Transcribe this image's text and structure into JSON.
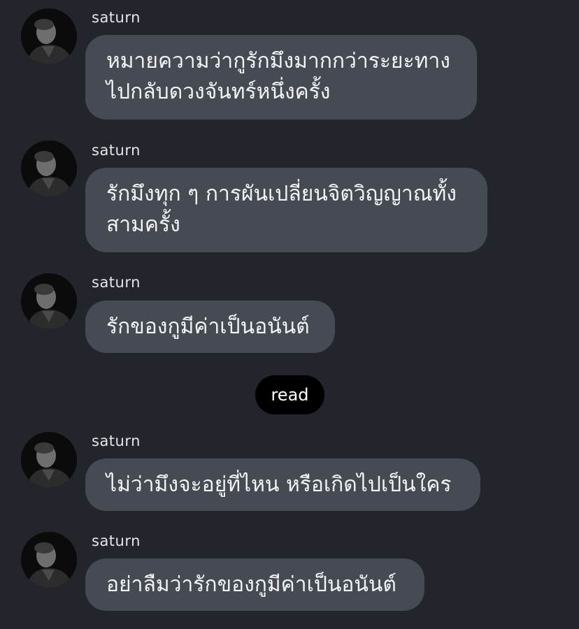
{
  "messages": [
    {
      "sender": "saturn",
      "text": "หมายความว่ากูรักมึงมากกว่าระยะทาง\nไปกลับดวงจันทร์หนึ่งครั้ง"
    },
    {
      "sender": "saturn",
      "text": "รักมึงทุก ๆ การผันเปลี่ยนจิตวิญญาณทั้ง\nสามครั้ง"
    },
    {
      "sender": "saturn",
      "text": "รักของกูมีค่าเป็นอนันต์"
    },
    {
      "sender": "saturn",
      "text": "ไม่ว่ามึงจะอยู่ที่ไหน หรือเกิดไปเป็นใคร"
    },
    {
      "sender": "saturn",
      "text": "อย่าลืมว่ารักของกูมีค่าเป็นอนันต์"
    }
  ],
  "read_receipt": "read",
  "avatar_icon": "profile-photo",
  "colors": {
    "background": "#23252d",
    "bubble": "#464a52",
    "read_pill": "#000000"
  }
}
